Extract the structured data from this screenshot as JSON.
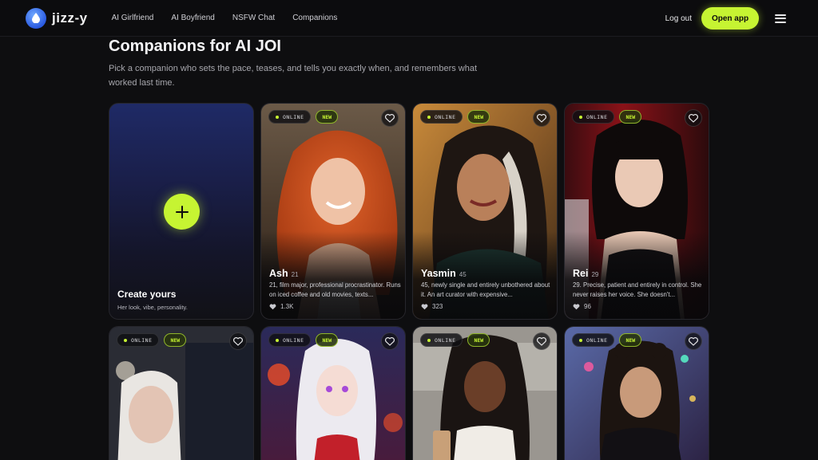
{
  "app": {
    "logo_text": "jizz-y"
  },
  "nav": {
    "links": [
      "AI Girlfriend",
      "AI Boyfriend",
      "NSFW Chat",
      "Companions"
    ],
    "logout": "Log out",
    "open_app": "Open app"
  },
  "page": {
    "title": "Companions for AI JOI",
    "subtitle": "Pick a companion who sets the pace, teases, and tells you exactly when, and remembers what worked last time."
  },
  "create_card": {
    "title": "Create yours",
    "subtitle": "Her look, vibe, personality."
  },
  "badges": {
    "online": "ONLINE",
    "new": "NEW"
  },
  "companions": [
    {
      "name": "Ash",
      "age": "21",
      "desc": "21, film major, professional procrastinator. Runs on iced coffee and old movies, texts...",
      "likes": "1.3K"
    },
    {
      "name": "Yasmin",
      "age": "45",
      "desc": "45, newly single and entirely unbothered about it. An art curator with expensive...",
      "likes": "323"
    },
    {
      "name": "Rei",
      "age": "29",
      "desc": "29. Precise, patient and entirely in control. She never raises her voice. She doesn't...",
      "likes": "96"
    }
  ],
  "colors": {
    "accent": "#c6f432",
    "background": "#0e0e10"
  }
}
